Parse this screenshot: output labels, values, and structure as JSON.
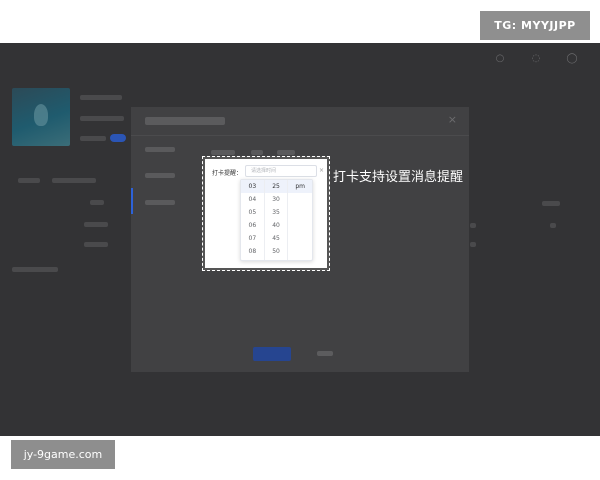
{
  "watermark_top": "TG: MYYJJPP",
  "watermark_bottom": "jy-9game.com",
  "reminder": {
    "label": "打卡提醒：",
    "placeholder": "请选择时间",
    "clear_glyph": "×"
  },
  "time_picker": {
    "hours": [
      "03",
      "04",
      "05",
      "06",
      "07",
      "08"
    ],
    "minutes": [
      "25",
      "30",
      "35",
      "40",
      "45",
      "50"
    ],
    "periods": [
      "pm"
    ],
    "selected": {
      "hour": "03",
      "minute": "25",
      "period": "pm"
    }
  },
  "annotation": "打卡支持设置消息提醒",
  "colors": {
    "overlay": "#333335",
    "modal": "#414143",
    "accent": "#2d62d8",
    "annotation_text": "#ffffff"
  },
  "icons": [
    "notification-icon",
    "help-icon",
    "user-icon",
    "close-icon"
  ]
}
